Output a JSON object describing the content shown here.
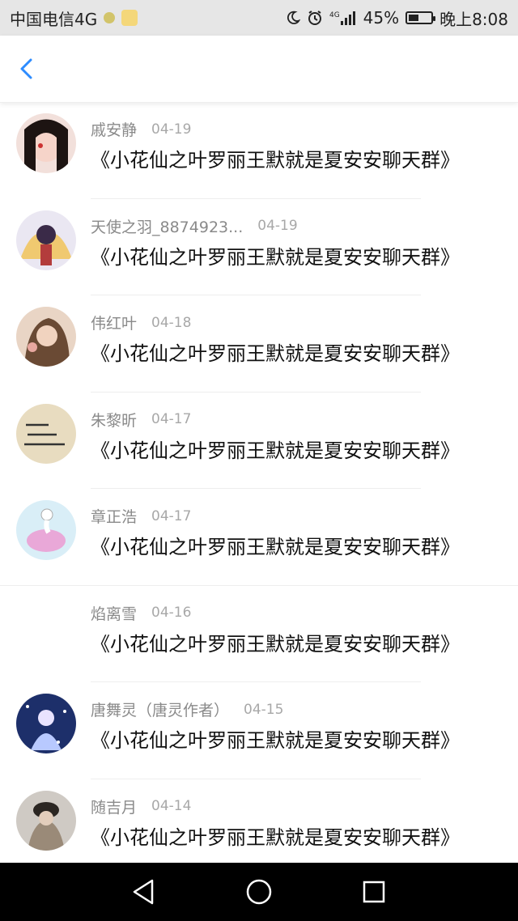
{
  "status_bar": {
    "carrier": "中国电信4G",
    "network": "4G",
    "battery": "45%",
    "time": "晚上8:08",
    "icons": [
      "dot-icon",
      "app-icon",
      "moon-icon",
      "alarm-icon",
      "signal-icon",
      "battery-icon"
    ]
  },
  "header": {
    "back_icon": "chevron-left-icon",
    "accent": "#2d8cff"
  },
  "conversations": [
    {
      "name": "戚安静",
      "date": "04-19",
      "message": "《小花仙之叶罗丽王默就是夏安安聊天群》"
    },
    {
      "name": "天使之羽_8874923...",
      "date": "04-19",
      "message": "《小花仙之叶罗丽王默就是夏安安聊天群》"
    },
    {
      "name": "伟红叶",
      "date": "04-18",
      "message": "《小花仙之叶罗丽王默就是夏安安聊天群》"
    },
    {
      "name": "朱黎昕",
      "date": "04-17",
      "message": "《小花仙之叶罗丽王默就是夏安安聊天群》"
    },
    {
      "name": "章正浩",
      "date": "04-17",
      "message": "《小花仙之叶罗丽王默就是夏安安聊天群》"
    },
    {
      "name": "焰离雪",
      "date": "04-16",
      "message": "《小花仙之叶罗丽王默就是夏安安聊天群》"
    },
    {
      "name": "唐舞灵（唐灵作者）",
      "date": "04-15",
      "message": "《小花仙之叶罗丽王默就是夏安安聊天群》"
    },
    {
      "name": "随吉月",
      "date": "04-14",
      "message": "《小花仙之叶罗丽王默就是夏安安聊天群》"
    }
  ],
  "navigation_bar": {
    "icons": [
      "back-triangle-icon",
      "home-circle-icon",
      "recent-square-icon"
    ]
  }
}
